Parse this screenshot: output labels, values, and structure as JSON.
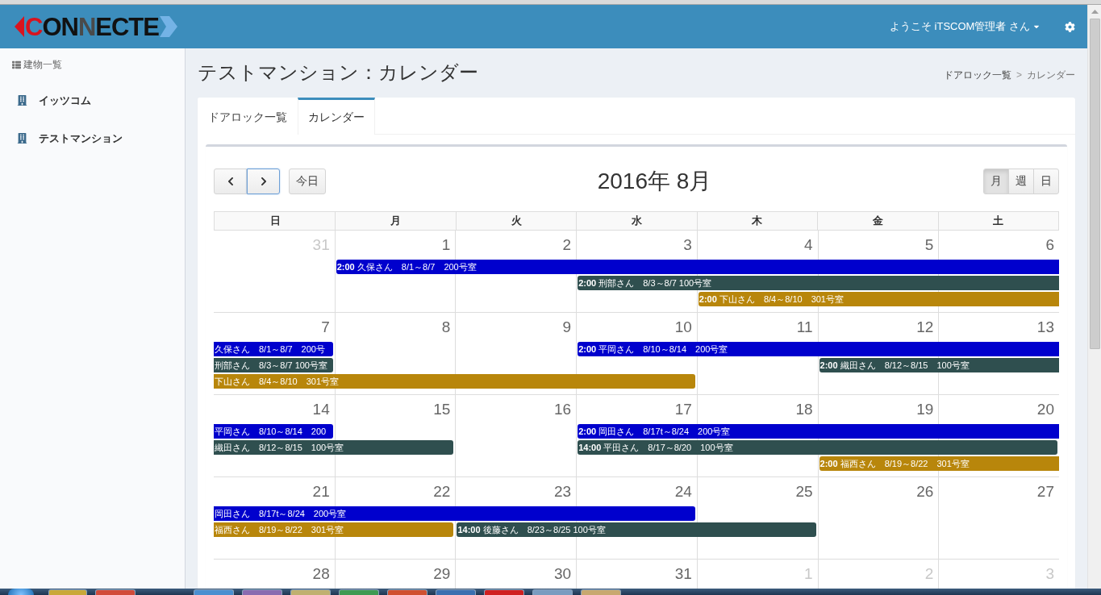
{
  "header": {
    "logo": [
      {
        "text": "C",
        "color": "#d9131e"
      },
      {
        "text": "ON",
        "color": "#111111"
      },
      {
        "text": "N",
        "color": "#4a4a4a"
      },
      {
        "text": "ECTE",
        "color": "#111111"
      }
    ],
    "user_menu": "ようこそ iTSCOM管理者 さん"
  },
  "sidebar": {
    "heading": "建物一覧",
    "items": [
      {
        "label": "イッツコム",
        "selected": false
      },
      {
        "label": "テストマンション",
        "selected": false
      }
    ]
  },
  "page": {
    "title": "テストマンション：カレンダー",
    "breadcrumb": {
      "separator": ">",
      "items": [
        {
          "label": "ドアロック一覧",
          "active": false
        },
        {
          "label": "カレンダー",
          "active": true
        }
      ]
    }
  },
  "tabs": [
    {
      "label": "ドアロック一覧",
      "selected": false
    },
    {
      "label": "カレンダー",
      "selected": true
    }
  ],
  "calendar": {
    "nav_buttons": [
      {
        "kind": "prev",
        "focused": false
      },
      {
        "kind": "next",
        "focused": true
      }
    ],
    "today_button": "今日",
    "title": "2016年 8月",
    "views": [
      {
        "label": "月",
        "selected": true
      },
      {
        "label": "週",
        "selected": false
      },
      {
        "label": "日",
        "selected": false
      }
    ],
    "weekdays": [
      "日",
      "月",
      "火",
      "水",
      "木",
      "金",
      "土"
    ],
    "weeks": [
      {
        "days": [
          {
            "number": "31",
            "other_month": true
          },
          {
            "number": "1",
            "other_month": false
          },
          {
            "number": "2",
            "other_month": false
          },
          {
            "number": "3",
            "other_month": false
          },
          {
            "number": "4",
            "other_month": false
          },
          {
            "number": "5",
            "other_month": false
          },
          {
            "number": "6",
            "other_month": false
          }
        ],
        "lanes": [
          [
            {
              "kind": "empty"
            },
            {
              "kind": "event",
              "time": "2:00",
              "title": "久保さん　8/1～8/7　200号室",
              "color": "#0000cd",
              "continues_before": false,
              "continues_after": true
            },
            {
              "kind": "continued"
            },
            {
              "kind": "continued"
            },
            {
              "kind": "continued"
            },
            {
              "kind": "continued"
            },
            {
              "kind": "continued"
            }
          ],
          [
            {
              "kind": "empty"
            },
            {
              "kind": "empty"
            },
            {
              "kind": "empty"
            },
            {
              "kind": "event",
              "time": "2:00",
              "title": "刑部さん　8/3～8/7 100号室",
              "color": "#2f4f4f",
              "continues_before": false,
              "continues_after": true
            },
            {
              "kind": "continued"
            },
            {
              "kind": "continued"
            },
            {
              "kind": "continued"
            }
          ],
          [
            {
              "kind": "empty"
            },
            {
              "kind": "empty"
            },
            {
              "kind": "empty"
            },
            {
              "kind": "empty"
            },
            {
              "kind": "event",
              "time": "2:00",
              "title": "下山さん　8/4～8/10　301号室",
              "color": "#b8860b",
              "continues_before": false,
              "continues_after": true
            },
            {
              "kind": "continued"
            },
            {
              "kind": "continued"
            }
          ]
        ]
      },
      {
        "days": [
          {
            "number": "7",
            "other_month": false
          },
          {
            "number": "8",
            "other_month": false
          },
          {
            "number": "9",
            "other_month": false
          },
          {
            "number": "10",
            "other_month": false
          },
          {
            "number": "11",
            "other_month": false
          },
          {
            "number": "12",
            "other_month": false
          },
          {
            "number": "13",
            "other_month": false
          }
        ],
        "lanes": [
          [
            {
              "kind": "event",
              "title": "久保さん　8/1～8/7　200号",
              "color": "#0000cd",
              "continues_before": true,
              "continues_after": false
            },
            {
              "kind": "empty"
            },
            {
              "kind": "empty"
            },
            {
              "kind": "event",
              "time": "2:00",
              "title": "平岡さん　8/10～8/14　200号室",
              "color": "#0000cd",
              "continues_before": false,
              "continues_after": true
            },
            {
              "kind": "continued"
            },
            {
              "kind": "continued"
            },
            {
              "kind": "continued"
            }
          ],
          [
            {
              "kind": "event",
              "title": "刑部さん　8/3～8/7 100号室",
              "color": "#2f4f4f",
              "continues_before": true,
              "continues_after": false
            },
            {
              "kind": "empty"
            },
            {
              "kind": "empty"
            },
            {
              "kind": "empty"
            },
            {
              "kind": "empty"
            },
            {
              "kind": "event",
              "time": "2:00",
              "title": "織田さん　8/12～8/15　100号室",
              "color": "#2f4f4f",
              "continues_before": false,
              "continues_after": true
            },
            {
              "kind": "continued"
            }
          ],
          [
            {
              "kind": "event",
              "title": "下山さん　8/4～8/10　301号室",
              "color": "#b8860b",
              "continues_before": true,
              "continues_after": false
            },
            {
              "kind": "continued"
            },
            {
              "kind": "continued"
            },
            {
              "kind": "continued"
            },
            {
              "kind": "empty"
            },
            {
              "kind": "empty"
            },
            {
              "kind": "empty"
            }
          ]
        ]
      },
      {
        "days": [
          {
            "number": "14",
            "other_month": false
          },
          {
            "number": "15",
            "other_month": false
          },
          {
            "number": "16",
            "other_month": false
          },
          {
            "number": "17",
            "other_month": false
          },
          {
            "number": "18",
            "other_month": false
          },
          {
            "number": "19",
            "other_month": false
          },
          {
            "number": "20",
            "other_month": false
          }
        ],
        "lanes": [
          [
            {
              "kind": "event",
              "title": "平岡さん　8/10～8/14　200",
              "color": "#0000cd",
              "continues_before": true,
              "continues_after": false
            },
            {
              "kind": "empty"
            },
            {
              "kind": "empty"
            },
            {
              "kind": "event",
              "time": "2:00",
              "title": "岡田さん　8/17t～8/24　200号室",
              "color": "#0000cd",
              "continues_before": false,
              "continues_after": true
            },
            {
              "kind": "continued"
            },
            {
              "kind": "continued"
            },
            {
              "kind": "continued"
            }
          ],
          [
            {
              "kind": "event",
              "title": "織田さん　8/12～8/15　100号室",
              "color": "#2f4f4f",
              "continues_before": true,
              "continues_after": false
            },
            {
              "kind": "continued"
            },
            {
              "kind": "empty"
            },
            {
              "kind": "event",
              "time": "14:00",
              "title": "平田さん　8/17～8/20　100号室",
              "color": "#2f4f4f",
              "continues_before": false,
              "continues_after": false
            },
            {
              "kind": "continued"
            },
            {
              "kind": "continued"
            },
            {
              "kind": "continued"
            }
          ],
          [
            {
              "kind": "empty"
            },
            {
              "kind": "empty"
            },
            {
              "kind": "empty"
            },
            {
              "kind": "empty"
            },
            {
              "kind": "empty"
            },
            {
              "kind": "event",
              "time": "2:00",
              "title": "福西さん　8/19～8/22　301号室",
              "color": "#b8860b",
              "continues_before": false,
              "continues_after": true
            },
            {
              "kind": "continued"
            }
          ]
        ]
      },
      {
        "days": [
          {
            "number": "21",
            "other_month": false
          },
          {
            "number": "22",
            "other_month": false
          },
          {
            "number": "23",
            "other_month": false
          },
          {
            "number": "24",
            "other_month": false
          },
          {
            "number": "25",
            "other_month": false
          },
          {
            "number": "26",
            "other_month": false
          },
          {
            "number": "27",
            "other_month": false
          }
        ],
        "lanes": [
          [
            {
              "kind": "event",
              "title": "岡田さん　8/17t～8/24　200号室",
              "color": "#0000cd",
              "continues_before": true,
              "continues_after": false
            },
            {
              "kind": "continued"
            },
            {
              "kind": "continued"
            },
            {
              "kind": "continued"
            },
            {
              "kind": "empty"
            },
            {
              "kind": "empty"
            },
            {
              "kind": "empty"
            }
          ],
          [
            {
              "kind": "event",
              "title": "福西さん　8/19～8/22　301号室",
              "color": "#b8860b",
              "continues_before": true,
              "continues_after": false
            },
            {
              "kind": "continued"
            },
            {
              "kind": "event",
              "time": "14:00",
              "title": "後藤さん　8/23～8/25 100号室",
              "color": "#2f4f4f",
              "continues_before": false,
              "continues_after": false
            },
            {
              "kind": "continued"
            },
            {
              "kind": "continued"
            },
            {
              "kind": "empty"
            },
            {
              "kind": "empty"
            }
          ]
        ]
      },
      {
        "days": [
          {
            "number": "28",
            "other_month": false
          },
          {
            "number": "29",
            "other_month": false
          },
          {
            "number": "30",
            "other_month": false
          },
          {
            "number": "31",
            "other_month": false
          },
          {
            "number": "1",
            "other_month": true
          },
          {
            "number": "2",
            "other_month": true
          },
          {
            "number": "3",
            "other_month": true
          }
        ]
      }
    ]
  }
}
